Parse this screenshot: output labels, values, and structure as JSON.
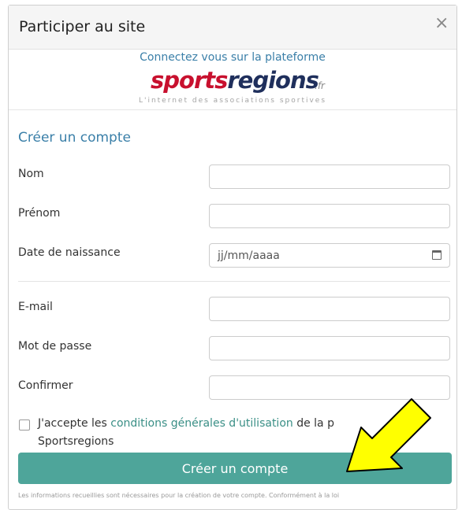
{
  "dialog": {
    "title": "Participer au site",
    "close_symbol": "×"
  },
  "brand": {
    "connect_text": "Connectez vous sur la plateforme",
    "logo_text": "sportsregions",
    "logo_suffix": ".fr",
    "tagline": "L'internet des associations sportives"
  },
  "form": {
    "section_title": "Créer un compte",
    "fields": [
      {
        "label": "Nom",
        "value": "",
        "placeholder": ""
      },
      {
        "label": "Prénom",
        "value": "",
        "placeholder": ""
      },
      {
        "label": "Date de naissance",
        "value": "",
        "placeholder": "jj/mm/aaaa"
      },
      {
        "label": "E-mail",
        "value": "",
        "placeholder": ""
      },
      {
        "label": "Mot de passe",
        "value": "",
        "placeholder": ""
      },
      {
        "label": "Confirmer",
        "value": "",
        "placeholder": ""
      }
    ],
    "terms": {
      "prefix": "J'accepte les ",
      "link": "conditions générales d'utilisation",
      "suffix": " de la p",
      "line2": "Sportsregions"
    },
    "submit_label": "Créer un compte",
    "footer_partial": "Les informations recueillies sont nécessaires pour la création de votre compte. Conformément à la loi"
  },
  "colors": {
    "accent_blue": "#3a7fa8",
    "button_teal": "#4ea59a",
    "logo_red": "#c8102e",
    "logo_navy": "#1f2f5c",
    "arrow_yellow": "#ffff00"
  },
  "icons": {
    "close": "close-icon",
    "calendar": "calendar-icon",
    "arrow": "arrow-annotation-icon"
  }
}
